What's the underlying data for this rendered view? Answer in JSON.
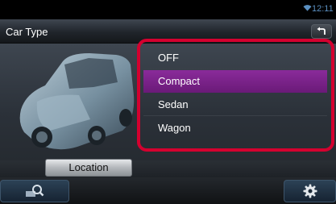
{
  "status": {
    "time": "12:11"
  },
  "header": {
    "title": "Car Type",
    "back_icon": "back-arrow-icon"
  },
  "car_type_options": [
    {
      "label": "OFF",
      "selected": false
    },
    {
      "label": "Compact",
      "selected": true
    },
    {
      "label": "Sedan",
      "selected": false
    },
    {
      "label": "Wagon",
      "selected": false
    }
  ],
  "buttons": {
    "location": "Location"
  },
  "footer": {
    "left_icon": "source-search-icon",
    "right_icon": "gear-icon"
  },
  "colors": {
    "selection": "#7a2289",
    "highlight_box": "#d4002f",
    "clock": "#5a8fc0"
  }
}
